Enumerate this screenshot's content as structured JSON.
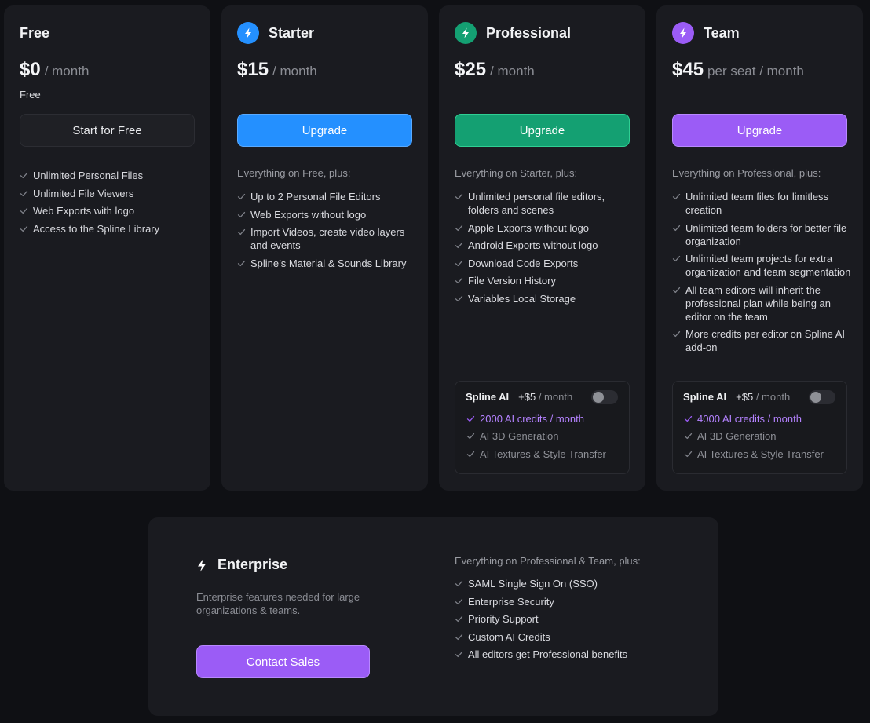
{
  "colors": {
    "starter": "#2490ff",
    "professional": "#14a072",
    "team": "#9b5cf6",
    "check": "#7f8189",
    "check_highlight": "#9b5cf6"
  },
  "plans": {
    "free": {
      "title": "Free",
      "price": "$0",
      "price_suffix": "/ month",
      "price_sub": "Free",
      "button": "Start for Free",
      "features": [
        "Unlimited Personal Files",
        "Unlimited File Viewers",
        "Web Exports with logo",
        "Access to the Spline Library"
      ]
    },
    "starter": {
      "title": "Starter",
      "icon": "bolt-icon",
      "price": "$15",
      "price_suffix": "/ month",
      "button": "Upgrade",
      "intro": "Everything on Free, plus:",
      "features": [
        "Up to 2 Personal File Editors",
        "Web Exports without logo",
        "Import Videos, create video layers and events",
        "Spline’s Material & Sounds Library"
      ]
    },
    "professional": {
      "title": "Professional",
      "icon": "bolt-icon",
      "price": "$25",
      "price_suffix": "/ month",
      "button": "Upgrade",
      "intro": "Everything on Starter, plus:",
      "features": [
        "Unlimited personal file editors, folders and scenes",
        "Apple Exports without logo",
        "Android Exports without logo",
        "Download Code Exports",
        "File Version History",
        "Variables Local Storage"
      ],
      "ai": {
        "title": "Spline AI",
        "price": "+$5",
        "price_suffix": "/ month",
        "enabled": false,
        "items": [
          "2000 AI credits / month",
          "AI 3D Generation",
          "AI Textures & Style Transfer"
        ]
      }
    },
    "team": {
      "title": "Team",
      "icon": "bolt-icon",
      "price": "$45",
      "price_suffix": "per seat / month",
      "button": "Upgrade",
      "intro": "Everything on Professional, plus:",
      "features": [
        "Unlimited team files for limitless creation",
        "Unlimited team folders for better file organization",
        "Unlimited team projects for extra organization and team segmentation",
        "All team editors will inherit the professional plan while being an editor on the team",
        "More credits per editor on Spline AI add-on"
      ],
      "ai": {
        "title": "Spline AI",
        "price": "+$5",
        "price_suffix": "/ month",
        "enabled": false,
        "items": [
          "4000 AI credits / month",
          "AI 3D Generation",
          "AI Textures & Style Transfer"
        ]
      }
    }
  },
  "enterprise": {
    "title": "Enterprise",
    "icon": "bolt-icon",
    "description": "Enterprise features needed for large organizations & teams.",
    "button": "Contact Sales",
    "intro": "Everything on Professional & Team, plus:",
    "features": [
      "SAML Single Sign On (SSO)",
      "Enterprise Security",
      "Priority Support",
      "Custom AI Credits",
      "All editors get Professional benefits"
    ]
  }
}
